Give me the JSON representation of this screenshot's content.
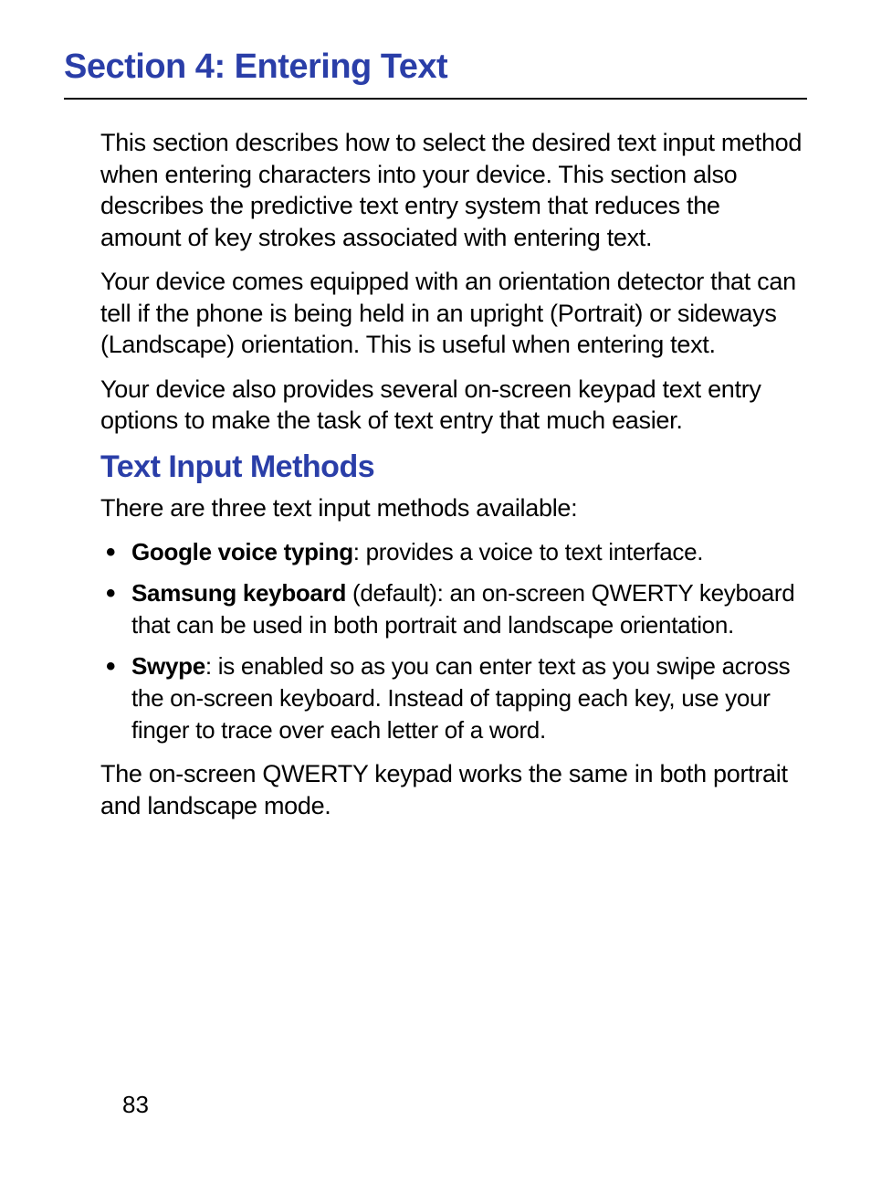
{
  "section_title": "Section 4: Entering Text",
  "para1": "This section describes how to select the desired text input method when entering characters into your device. This section also describes the predictive text entry system that reduces the amount of key strokes associated with entering text.",
  "para2": "Your device comes equipped with an orientation detector that can tell if the phone is being held in an upright (Portrait) or sideways (Landscape) orientation. This is useful when entering text.",
  "para3": "Your device also provides several on-screen keypad text entry options to make the task of text entry that much easier.",
  "sub_heading": "Text Input Methods",
  "para4": "There are three text input methods available:",
  "bullets": [
    {
      "bold": "Google voice typing",
      "rest": ": provides a voice to text interface."
    },
    {
      "bold": "Samsung keyboard",
      "rest": " (default): an on-screen QWERTY keyboard that can be used in both portrait and landscape orientation."
    },
    {
      "bold": "Swype",
      "rest": ": is enabled so as you can enter text as you swipe across the on-screen keyboard. Instead of tapping each key, use your finger to trace over each letter of a word."
    }
  ],
  "para5": "The on-screen QWERTY keypad works the same in both portrait and landscape mode.",
  "page_number": "83"
}
